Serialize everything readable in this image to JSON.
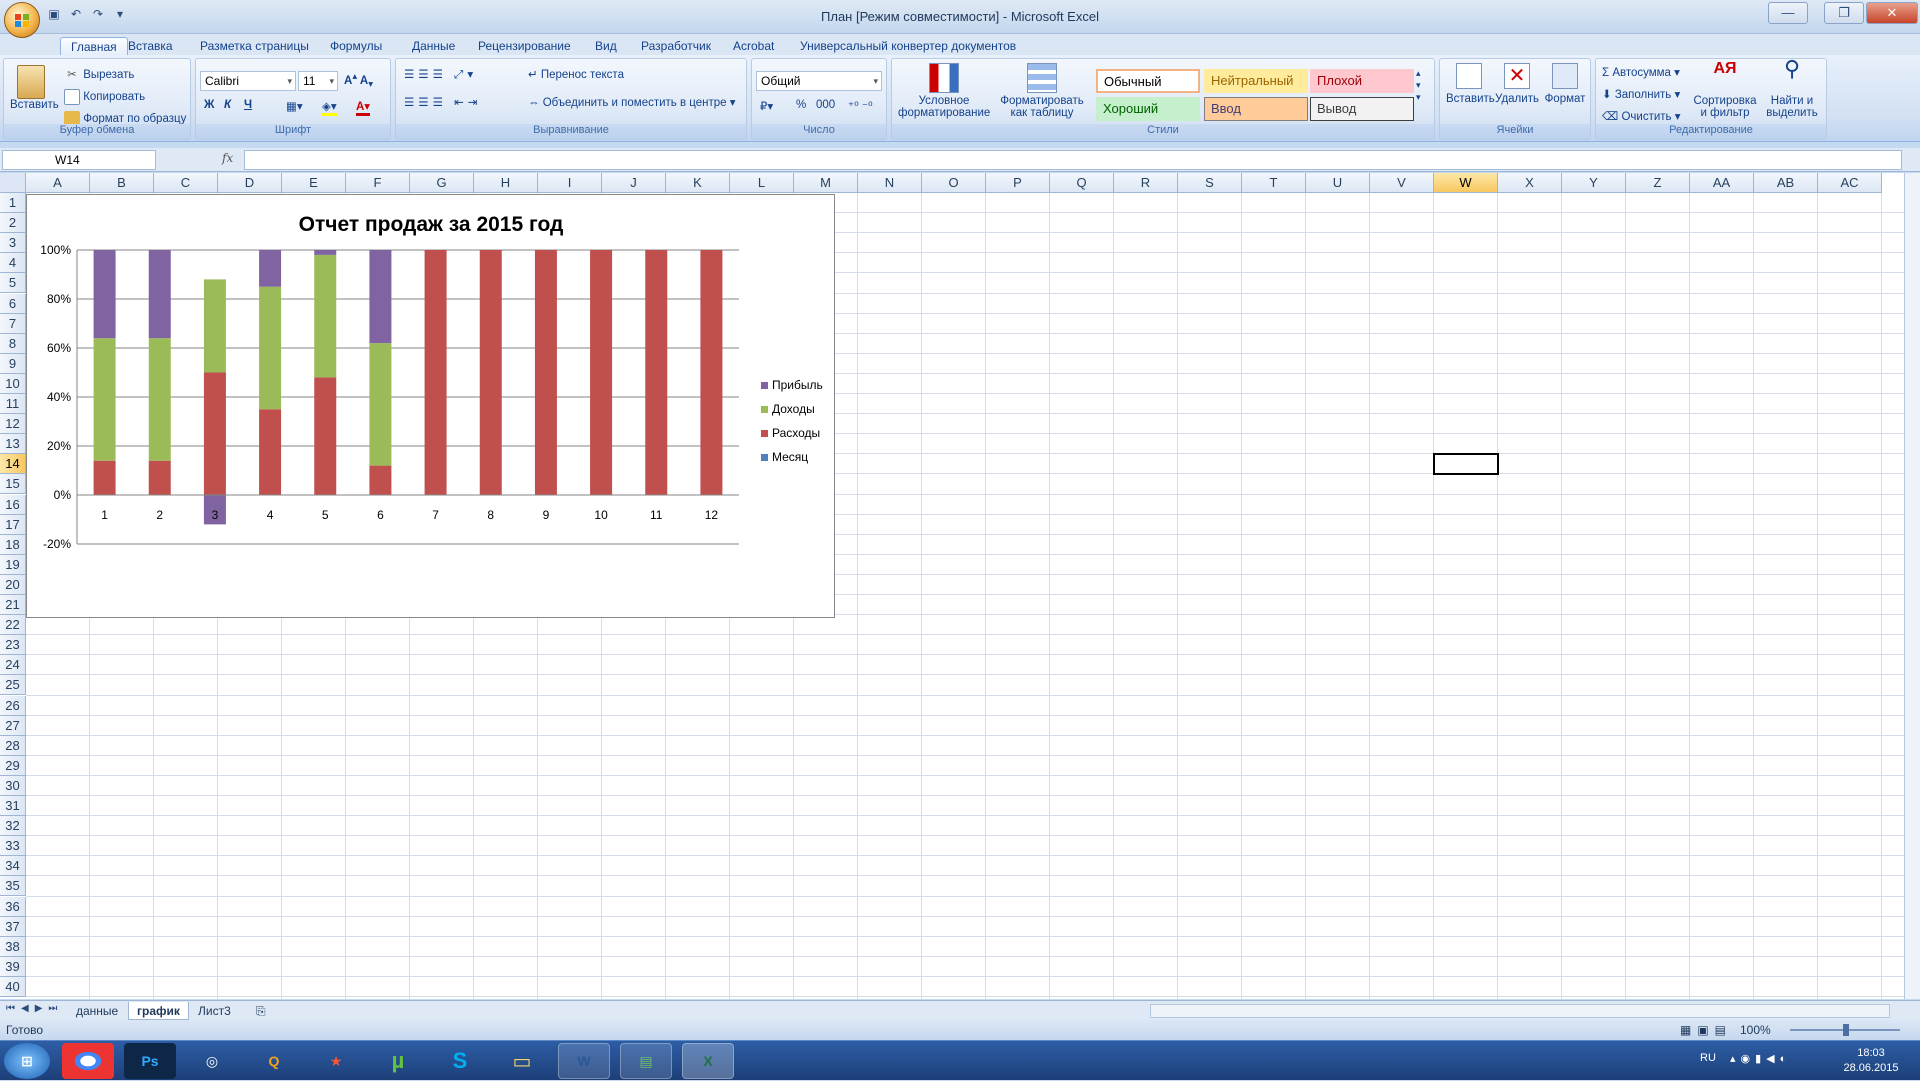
{
  "window": {
    "title": "План  [Режим совместимости] - Microsoft Excel"
  },
  "ribbon_tabs": [
    "Главная",
    "Вставка",
    "Разметка страницы",
    "Формулы",
    "Данные",
    "Рецензирование",
    "Вид",
    "Разработчик",
    "Acrobat",
    "Универсальный конвертер документов"
  ],
  "clipboard": {
    "paste": "Вставить",
    "cut": "Вырезать",
    "copy": "Копировать",
    "format_painter": "Формат по образцу",
    "label": "Буфер обмена"
  },
  "font": {
    "name": "Calibri",
    "size": "11",
    "bold": "Ж",
    "italic": "К",
    "underline": "Ч",
    "label": "Шрифт"
  },
  "alignment": {
    "wrap": "Перенос текста",
    "merge": "Объединить и поместить в центре",
    "label": "Выравнивание"
  },
  "number": {
    "format": "Общий",
    "percent": "%",
    "thousands": "000",
    "label": "Число"
  },
  "styles": {
    "conditional": "Условное форматирование",
    "as_table": "Форматировать как таблицу",
    "cells": [
      {
        "text": "Обычный",
        "bg": "#ffffff",
        "fg": "#000000",
        "border": "#f4b183"
      },
      {
        "text": "Нейтральный",
        "bg": "#ffeb9c",
        "fg": "#9c6500",
        "border": "#ffeb9c"
      },
      {
        "text": "Плохой",
        "bg": "#ffc7ce",
        "fg": "#9c0006",
        "border": "#ffc7ce"
      },
      {
        "text": "Хороший",
        "bg": "#c6efce",
        "fg": "#006100",
        "border": "#c6efce"
      },
      {
        "text": "Ввод",
        "bg": "#ffcc99",
        "fg": "#3f3f76",
        "border": "#7f7f7f"
      },
      {
        "text": "Вывод",
        "bg": "#f2f2f2",
        "fg": "#3f3f3f",
        "border": "#3f3f3f"
      }
    ],
    "label": "Стили"
  },
  "cells_group": {
    "insert": "Вставить",
    "delete": "Удалить",
    "format": "Формат",
    "label": "Ячейки"
  },
  "editing": {
    "autosum": "Автосумма",
    "fill": "Заполнить",
    "clear": "Очистить",
    "sort": "Сортировка и фильтр",
    "find": "Найти и выделить",
    "label": "Редактирование"
  },
  "formula_bar": {
    "name_box": "W14",
    "fx": "fx",
    "value": ""
  },
  "columns": [
    "A",
    "B",
    "C",
    "D",
    "E",
    "F",
    "G",
    "H",
    "I",
    "J",
    "K",
    "L",
    "M",
    "N",
    "O",
    "P",
    "Q",
    "R",
    "S",
    "T",
    "U",
    "V",
    "W",
    "X",
    "Y",
    "Z",
    "AA",
    "AB",
    "AC"
  ],
  "selected_column": "W",
  "selected_row": 14,
  "row_count": 40,
  "sheet_tabs": [
    "данные",
    "график",
    "Лист3"
  ],
  "active_sheet": "график",
  "status": {
    "ready": "Готово",
    "zoom": "100%"
  },
  "taskbar": {
    "lang": "RU",
    "time": "18:03",
    "date": "28.06.2015"
  },
  "chart_data": {
    "type": "bar",
    "stacked": "percent",
    "title": "Отчет продаж за 2015 год",
    "categories": [
      "1",
      "2",
      "3",
      "4",
      "5",
      "6",
      "7",
      "8",
      "9",
      "10",
      "11",
      "12"
    ],
    "ylim": [
      -0.2,
      1.0
    ],
    "yticks": [
      "-20%",
      "0%",
      "20%",
      "40%",
      "60%",
      "80%",
      "100%"
    ],
    "legend_position": "right",
    "series": [
      {
        "name": "Прибыль",
        "color": "#8064a2",
        "values": [
          0.36,
          0.36,
          -0.12,
          0.15,
          0.02,
          0.38,
          0,
          0,
          0,
          0,
          0,
          0
        ]
      },
      {
        "name": "Доходы",
        "color": "#9bbb59",
        "values": [
          0.5,
          0.5,
          0.38,
          0.5,
          0.5,
          0.5,
          0,
          0,
          0,
          0,
          0,
          0
        ]
      },
      {
        "name": "Расходы",
        "color": "#c0504d",
        "values": [
          0.14,
          0.14,
          0.5,
          0.35,
          0.48,
          0.12,
          1,
          1,
          1,
          1,
          1,
          1
        ]
      },
      {
        "name": "Месяц",
        "color": "#4f81bd",
        "values": [
          0,
          0,
          0,
          0,
          0,
          0,
          0,
          0,
          0,
          0,
          0,
          0
        ]
      }
    ]
  }
}
